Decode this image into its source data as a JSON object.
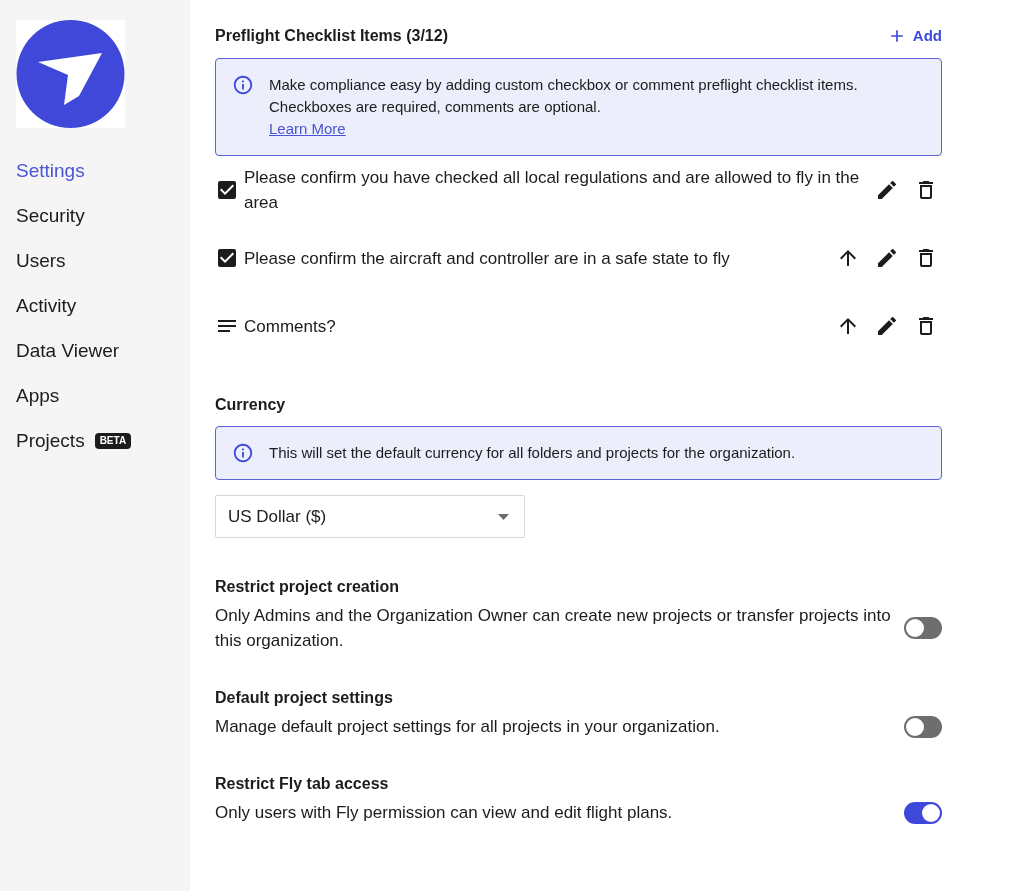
{
  "sidebar": {
    "items": [
      {
        "label": "Settings",
        "selected": true
      },
      {
        "label": "Security",
        "selected": false
      },
      {
        "label": "Users",
        "selected": false
      },
      {
        "label": "Activity",
        "selected": false
      },
      {
        "label": "Data Viewer",
        "selected": false
      },
      {
        "label": "Apps",
        "selected": false
      },
      {
        "label": "Projects",
        "selected": false,
        "badge": "BETA"
      }
    ]
  },
  "checklist": {
    "title": "Preflight Checklist Items (3/12)",
    "add_button": "Add",
    "info": {
      "lines": [
        "Make compliance easy by adding custom checkbox or comment preflight checklist items.",
        "Checkboxes are required, comments are optional."
      ],
      "link": "Learn More"
    },
    "items": [
      {
        "kind": "checkbox",
        "label": "Please confirm you have checked all local regulations and are allowed to fly in the area",
        "checked": true,
        "can_move_up": false
      },
      {
        "kind": "checkbox",
        "label": "Please confirm the aircraft and controller are in a safe state to fly",
        "checked": true,
        "can_move_up": true
      },
      {
        "kind": "comment",
        "label": "Comments?",
        "can_move_up": true
      }
    ]
  },
  "currency": {
    "title": "Currency",
    "info": "This will set the default currency for all folders and projects for the organization.",
    "select": {
      "value": "US Dollar ($)"
    }
  },
  "settings": [
    {
      "title": "Restrict project creation",
      "description": "Only Admins and the Organization Owner can create new projects or transfer projects into this organization.",
      "on": false
    },
    {
      "title": "Default project settings",
      "description": "Manage default project settings for all projects in your organization.",
      "on": false
    },
    {
      "title": "Restrict Fly tab access",
      "description": "Only users with Fly permission can view and edit flight plans.",
      "on": true
    }
  ]
}
